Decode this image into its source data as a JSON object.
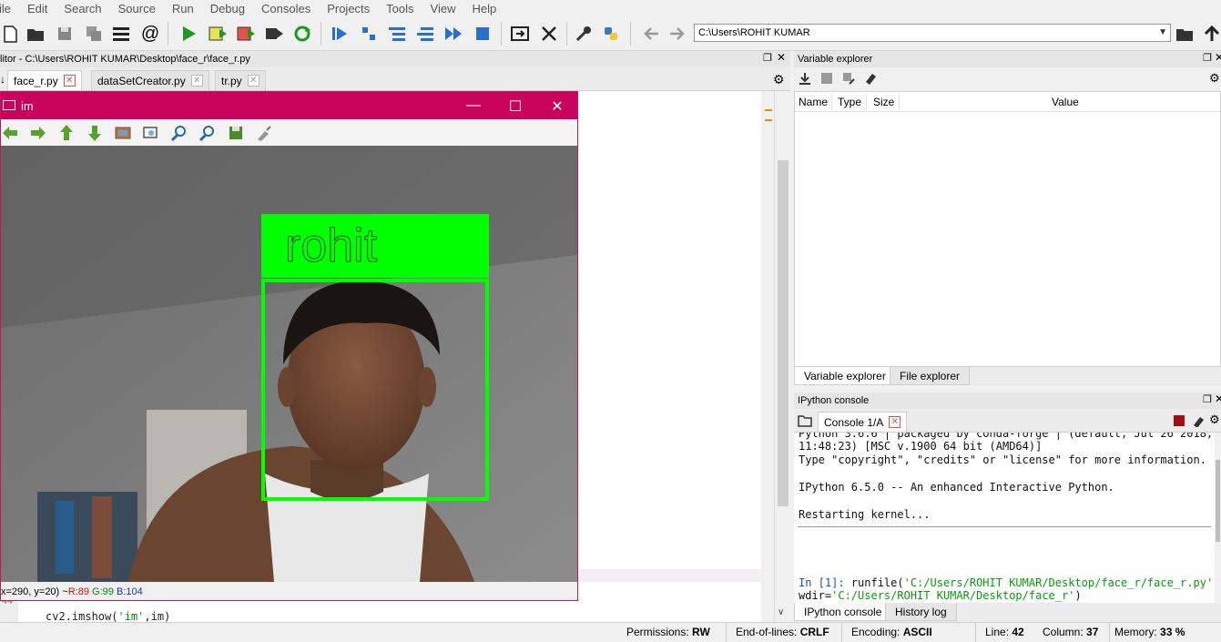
{
  "menu": [
    "ile",
    "Edit",
    "Search",
    "Source",
    "Run",
    "Debug",
    "Consoles",
    "Projects",
    "Tools",
    "View",
    "Help"
  ],
  "toolbar": {
    "path_value": "C:\\Users\\ROHIT KUMAR"
  },
  "editor": {
    "title": "litor - C:\\Users\\ROHIT KUMAR\\Desktop\\face_r\\face_r.py",
    "tabs": [
      {
        "label": "face_r.py",
        "active": true
      },
      {
        "label": "dataSetCreator.py",
        "active": false
      },
      {
        "label": "tr.py",
        "active": false
      }
    ],
    "line_number": "44",
    "code_prefix": "cv2.imshow(",
    "code_string": "'im'",
    "code_suffix": ",im)"
  },
  "image_window": {
    "title": "im",
    "label_text": "rohit",
    "status_coords": "x=290, y=20) ~ ",
    "status_r": "R:89",
    "status_g": "G:99",
    "status_b": "B:104",
    "box_color": "#00ff00",
    "title_color": "#c8035b"
  },
  "variable_explorer": {
    "title": "Variable explorer",
    "columns": [
      "Name",
      "Type",
      "Size",
      "Value"
    ],
    "tabs": [
      "Variable explorer",
      "File explorer"
    ]
  },
  "ipython": {
    "title": "IPython console",
    "tab_label": "Console 1/A",
    "lines": {
      "l1": "Python 3.6.6 | packaged by conda-forge | (default, Jul 26 2018,",
      "l2": "11:48:23) [MSC v.1900 64 bit (AMD64)]",
      "l3": "Type \"copyright\", \"credits\" or \"license\" for more information.",
      "l4": "IPython 6.5.0 -- An enhanced Interactive Python.",
      "l5": "Restarting kernel..."
    },
    "prompt": "In [1]:",
    "run_cmd": " runfile(",
    "run_path": "'C:/Users/ROHIT KUMAR/Desktop/face_r/face_r.py'",
    "run_comma": ",",
    "wdir_label": "wdir=",
    "wdir_path": "'C:/Users/ROHIT KUMAR/Desktop/face_r'",
    "close_paren": ")",
    "bottom_tabs": [
      "IPython console",
      "History log"
    ]
  },
  "status": {
    "permissions_label": "Permissions:",
    "permissions_value": "RW",
    "eol_label": "End-of-lines:",
    "eol_value": "CRLF",
    "encoding_label": "Encoding:",
    "encoding_value": "ASCII",
    "line_label": "Line:",
    "line_value": "42",
    "column_label": "Column:",
    "column_value": "37",
    "memory_label": "Memory:",
    "memory_value": "33 %"
  }
}
